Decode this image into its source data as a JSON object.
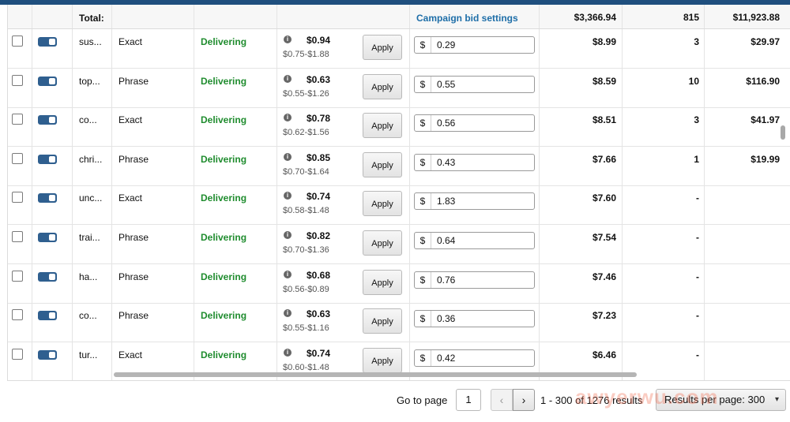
{
  "header": {
    "total_label": "Total:",
    "campaign_bid_settings": "Campaign bid settings",
    "total_spend": "$3,366.94",
    "total_clicks": "815",
    "total_sales": "$11,923.88"
  },
  "rows": [
    {
      "keyword": "sus...",
      "match": "Exact",
      "status": "Delivering",
      "suggested": "$0.94",
      "range": "$0.75-$1.88",
      "apply": "Apply",
      "bid": "0.29",
      "spend": "$8.99",
      "clicks": "3",
      "sales": "$29.97"
    },
    {
      "keyword": "top...",
      "match": "Phrase",
      "status": "Delivering",
      "suggested": "$0.63",
      "range": "$0.55-$1.26",
      "apply": "Apply",
      "bid": "0.55",
      "spend": "$8.59",
      "clicks": "10",
      "sales": "$116.90"
    },
    {
      "keyword": "co...",
      "match": "Exact",
      "status": "Delivering",
      "suggested": "$0.78",
      "range": "$0.62-$1.56",
      "apply": "Apply",
      "bid": "0.56",
      "spend": "$8.51",
      "clicks": "3",
      "sales": "$41.97"
    },
    {
      "keyword": "chri...",
      "match": "Phrase",
      "status": "Delivering",
      "suggested": "$0.85",
      "range": "$0.70-$1.64",
      "apply": "Apply",
      "bid": "0.43",
      "spend": "$7.66",
      "clicks": "1",
      "sales": "$19.99"
    },
    {
      "keyword": "unc...",
      "match": "Exact",
      "status": "Delivering",
      "suggested": "$0.74",
      "range": "$0.58-$1.48",
      "apply": "Apply",
      "bid": "1.83",
      "spend": "$7.60",
      "clicks": "-",
      "sales": ""
    },
    {
      "keyword": "trai...",
      "match": "Phrase",
      "status": "Delivering",
      "suggested": "$0.82",
      "range": "$0.70-$1.36",
      "apply": "Apply",
      "bid": "0.64",
      "spend": "$7.54",
      "clicks": "-",
      "sales": ""
    },
    {
      "keyword": "ha...",
      "match": "Phrase",
      "status": "Delivering",
      "suggested": "$0.68",
      "range": "$0.56-$0.89",
      "apply": "Apply",
      "bid": "0.76",
      "spend": "$7.46",
      "clicks": "-",
      "sales": ""
    },
    {
      "keyword": "co...",
      "match": "Phrase",
      "status": "Delivering",
      "suggested": "$0.63",
      "range": "$0.55-$1.16",
      "apply": "Apply",
      "bid": "0.36",
      "spend": "$7.23",
      "clicks": "-",
      "sales": ""
    },
    {
      "keyword": "tur...",
      "match": "Exact",
      "status": "Delivering",
      "suggested": "$0.74",
      "range": "$0.60-$1.48",
      "apply": "Apply",
      "bid": "0.42",
      "spend": "$6.46",
      "clicks": "-",
      "sales": ""
    }
  ],
  "pagination": {
    "goto_label": "Go to page",
    "page_value": "1",
    "prev_icon": "‹",
    "next_icon": "›",
    "results_text": "1 - 300 of 1276 results",
    "per_page_label": "Results per page: 300",
    "per_page_chevron": "▾"
  },
  "watermark": "awyerwu.com",
  "colors": {
    "topbar": "#1f4f7e",
    "status_green": "#1f8c2e",
    "link_blue": "#1e6ea8",
    "toggle_blue": "#2f5f8f"
  }
}
